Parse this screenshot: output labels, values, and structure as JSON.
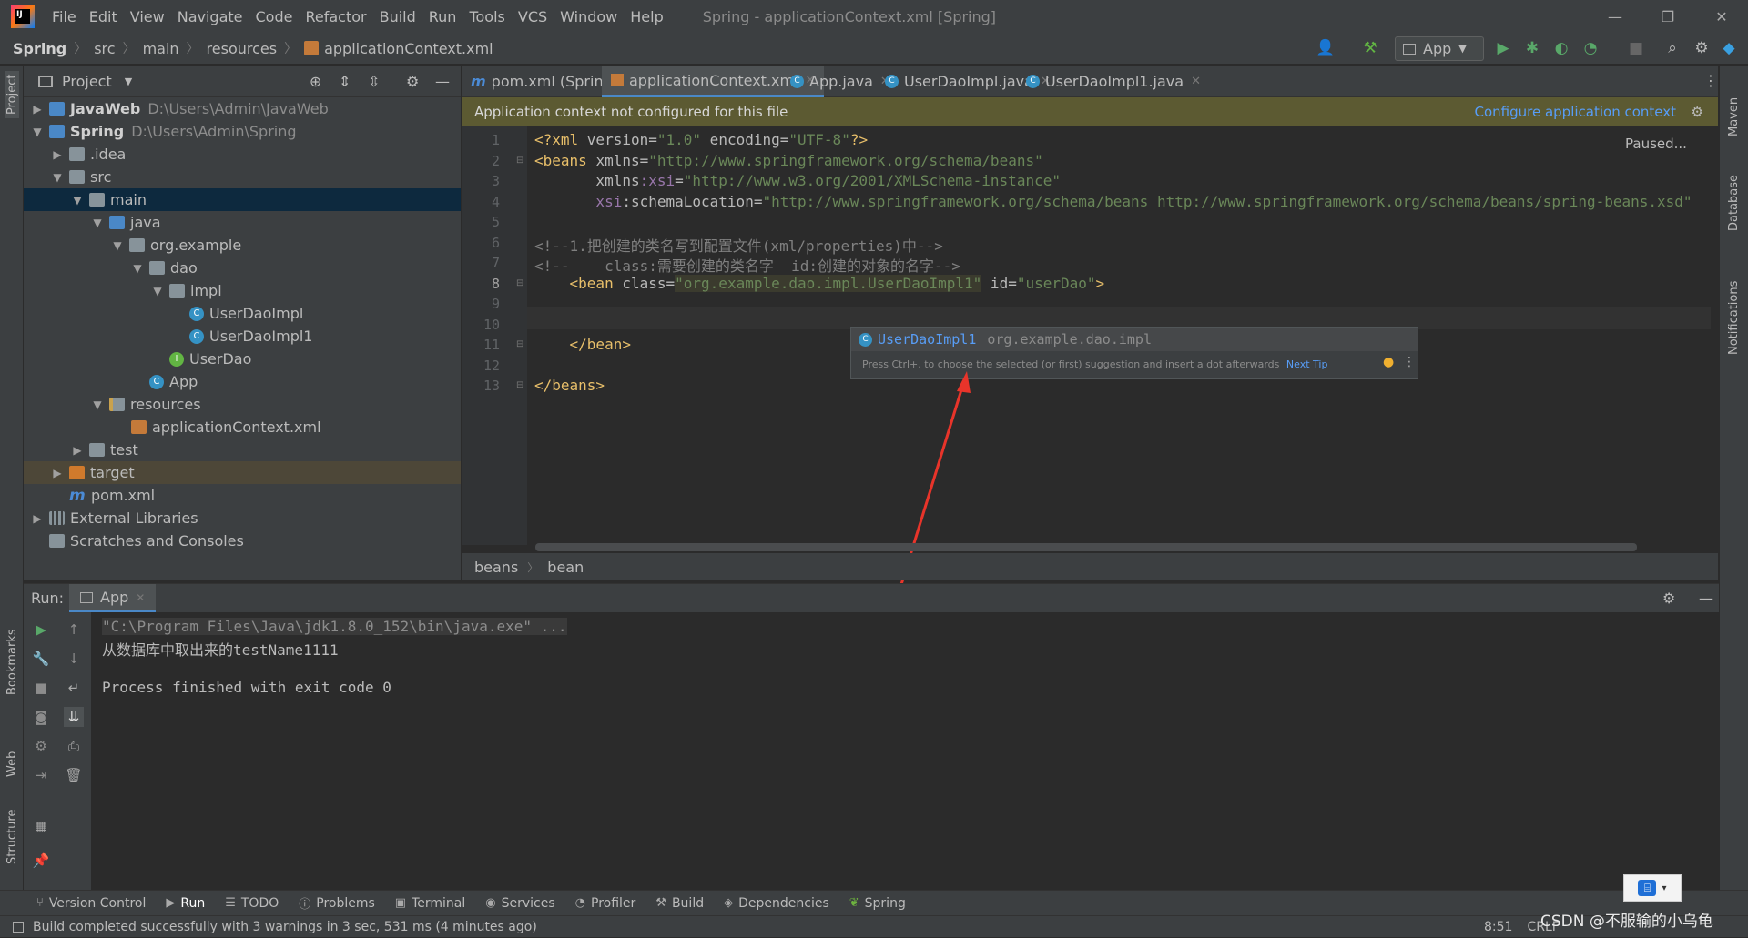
{
  "menu": [
    "File",
    "Edit",
    "View",
    "Navigate",
    "Code",
    "Refactor",
    "Build",
    "Run",
    "Tools",
    "VCS",
    "Window",
    "Help"
  ],
  "window_title": "Spring - applicationContext.xml [Spring]",
  "breadcrumb": [
    "Spring",
    "src",
    "main",
    "resources",
    "applicationContext.xml"
  ],
  "run_config": "App",
  "project_panel": {
    "title": "Project"
  },
  "tree": [
    {
      "label": "JavaWeb",
      "path": "D:\\Users\\Admin\\JavaWeb"
    },
    {
      "label": "Spring",
      "path": "D:\\Users\\Admin\\Spring"
    },
    {
      "label": ".idea"
    },
    {
      "label": "src"
    },
    {
      "label": "main"
    },
    {
      "label": "java"
    },
    {
      "label": "org.example"
    },
    {
      "label": "dao"
    },
    {
      "label": "impl"
    },
    {
      "label": "UserDaoImpl"
    },
    {
      "label": "UserDaoImpl1"
    },
    {
      "label": "UserDao"
    },
    {
      "label": "App"
    },
    {
      "label": "resources"
    },
    {
      "label": "applicationContext.xml"
    },
    {
      "label": "test"
    },
    {
      "label": "target"
    },
    {
      "label": "pom.xml"
    },
    {
      "label": "External Libraries"
    },
    {
      "label": "Scratches and Consoles"
    }
  ],
  "tabs": [
    "pom.xml (Spring)",
    "applicationContext.xml",
    "App.java",
    "UserDaoImpl.java",
    "UserDaoImpl1.java"
  ],
  "banner": {
    "text": "Application context not configured for this file",
    "link": "Configure application context"
  },
  "paused": "Paused...",
  "line_numbers": [
    "1",
    "2",
    "3",
    "4",
    "5",
    "6",
    "7",
    "8",
    "9",
    "10",
    "11",
    "12",
    "13"
  ],
  "code": {
    "l1a": "<?xml ",
    "l1b": "version",
    "l1c": "=",
    "l1d": "\"1.0\"",
    "l1e": " encoding",
    "l1f": "=",
    "l1g": "\"UTF-8\"",
    "l1h": "?>",
    "l2a": "<beans ",
    "l2b": "xmlns",
    "l2c": "=",
    "l2d": "\"http://www.springframework.org/schema/beans\"",
    "l3a": "       xmlns",
    "l3b": ":xsi",
    "l3c": "=",
    "l3d": "\"http://www.w3.org/2001/XMLSchema-instance\"",
    "l4a": "       xsi",
    "l4b": ":schemaLocation",
    "l4c": "=",
    "l4d": "\"http://www.springframework.org/schema/beans http://www.springframework.org/schema/beans/spring-beans.xsd\"",
    "l6": "<!--1.把创建的类名写到配置文件(xml/properties)中-->",
    "l7": "<!--    class:需要创建的类名字  id:创建的对象的名字-->",
    "l8a": "    <bean ",
    "l8b": "class",
    "l8c": "=",
    "l8d": "\"org.example.dao.impl.UserDaoImpl1\"",
    "l8e": " id",
    "l8f": "=",
    "l8g": "\"userDao\"",
    "l8h": ">",
    "l11": "    </bean>",
    "l13": "</beans>"
  },
  "completion": {
    "name": "UserDaoImpl1",
    "package": "org.example.dao.impl",
    "hint": "Press Ctrl+. to choose the selected (or first) suggestion and insert a dot afterwards",
    "next_tip": "Next Tip"
  },
  "editor_breadcrumb": [
    "beans",
    "bean"
  ],
  "run_panel": {
    "label": "Run:",
    "tab": "App"
  },
  "console": {
    "cmd": "\"C:\\Program Files\\Java\\jdk1.8.0_152\\bin\\java.exe\" ...",
    "out": "从数据库中取出来的testName1111",
    "exit": "Process finished with exit code 0"
  },
  "bottom_tools": [
    "Version Control",
    "Run",
    "TODO",
    "Problems",
    "Terminal",
    "Services",
    "Profiler",
    "Build",
    "Dependencies",
    "Spring"
  ],
  "status": {
    "message": "Build completed successfully with 3 warnings in 3 sec, 531 ms (4 minutes ago)",
    "position": "8:51",
    "line_sep": "CRLF"
  },
  "side_labels": {
    "left": [
      "Project",
      "Bookmarks",
      "Web",
      "Structure"
    ],
    "right": [
      "Maven",
      "Database",
      "Notifications"
    ]
  },
  "watermark": "CSDN @不服输的小乌龟",
  "colors": {
    "accent": "#4a88c7",
    "banner": "#5c5a32",
    "arrow": "#e8342a"
  }
}
